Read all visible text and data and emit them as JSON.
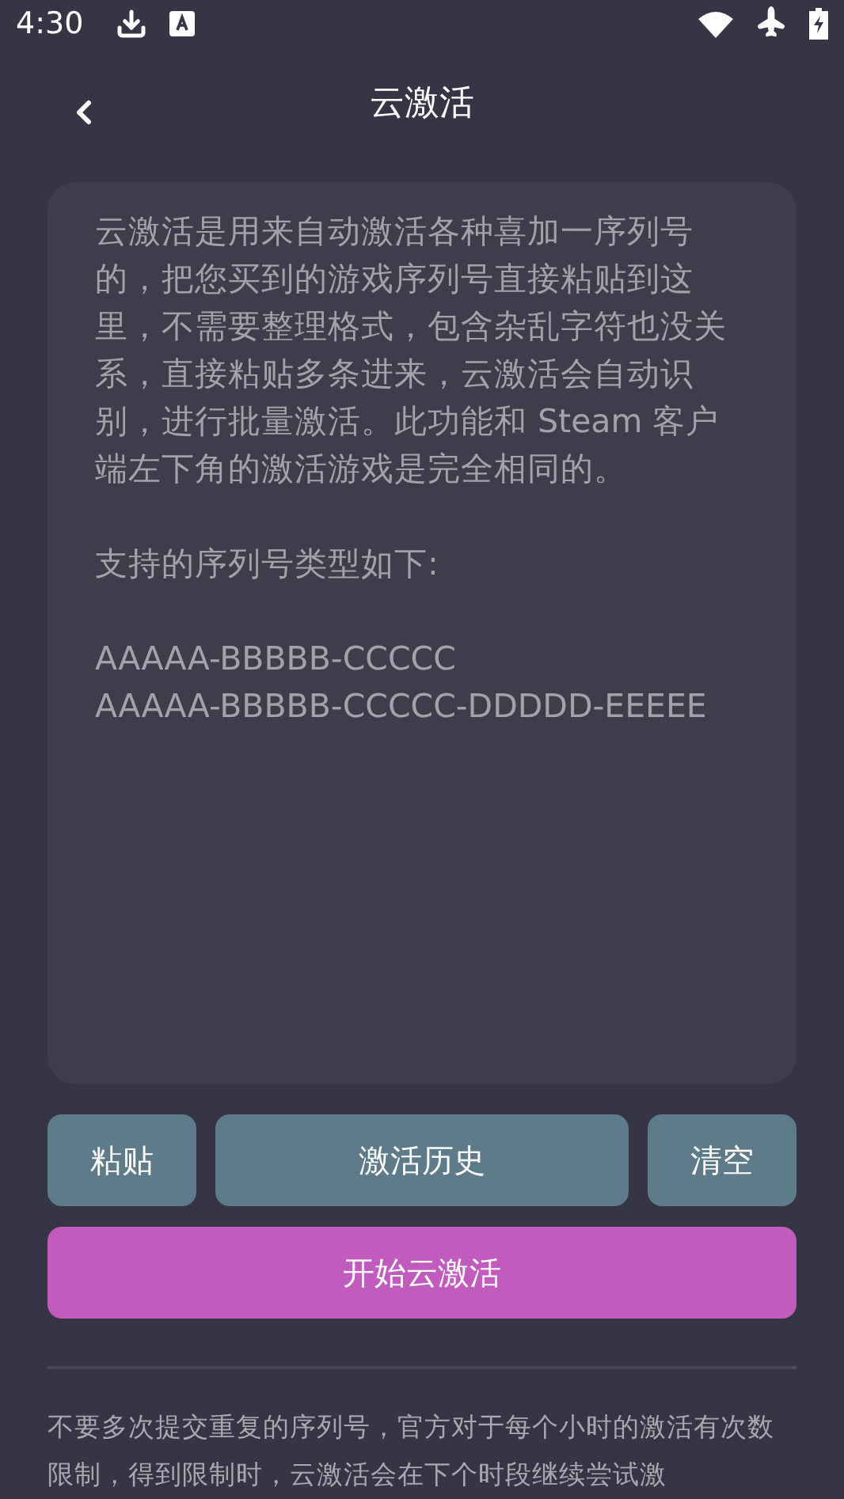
{
  "status_bar": {
    "time": "4:30"
  },
  "header": {
    "title": "云激活"
  },
  "serial_input": {
    "placeholder": [
      [
        "云激活是用来自动激活各种喜加一序列号的，把您买到的游戏序列号直接粘贴到这里，不需要整理格式，包含杂乱字符也没关系，直接粘贴多条进来，云激活会自动识别，进行批量激活。此功能和 Steam 客户端左下角的激活游戏是完全相同的。"
      ],
      [
        "支持的序列号类型如下:"
      ],
      [
        "AAAAA-BBBBB-CCCCC",
        "AAAAA-BBBBB-CCCCC-DDDDD-EEEEE"
      ]
    ]
  },
  "actions": [
    {
      "label": "粘贴",
      "kind": "small"
    },
    {
      "label": "激活历史",
      "kind": "wide"
    },
    {
      "label": "清空",
      "kind": "small"
    }
  ],
  "primary_button": {
    "label": "开始云激活"
  },
  "notice": "不要多次提交重复的序列号，官方对于每个小时的激活有次数限制，得到限制时，云激活会在下个时段继续尝试激"
}
